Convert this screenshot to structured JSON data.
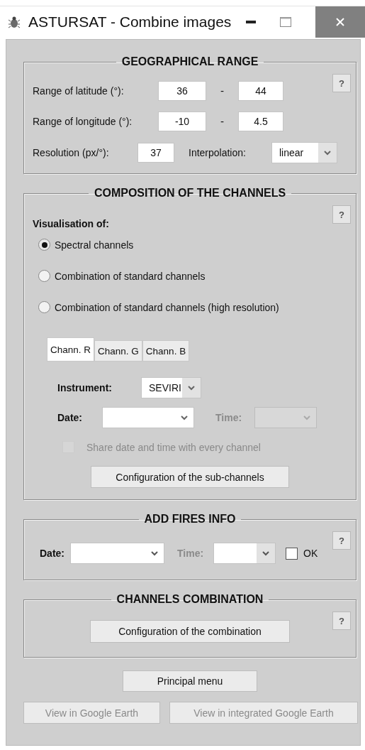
{
  "window": {
    "title": "ASTURSAT - Combine images"
  },
  "geographical_range": {
    "title": "GEOGRAPHICAL RANGE",
    "help": "?",
    "latitude": {
      "label": "Range of latitude (°):",
      "from": "36",
      "separator": "-",
      "to": "44"
    },
    "longitude": {
      "label": "Range of longitude (°):",
      "from": "-10",
      "separator": "-",
      "to": "4.5"
    },
    "resolution": {
      "label": "Resolution (px/°):",
      "value": "37"
    },
    "interpolation": {
      "label": "Interpolation:",
      "value": "linear"
    }
  },
  "composition": {
    "title": "COMPOSITION OF THE CHANNELS",
    "help": "?",
    "visualisation_label": "Visualisation of:",
    "options": [
      {
        "label": "Spectral channels",
        "selected": true
      },
      {
        "label": "Combination of standard channels",
        "selected": false
      },
      {
        "label": "Combination of standard channels (high resolution)",
        "selected": false
      }
    ],
    "tabs": [
      {
        "label": "Chann. R",
        "selected": true
      },
      {
        "label": "Chann. G",
        "selected": false
      },
      {
        "label": "Chann. B",
        "selected": false
      }
    ],
    "instrument": {
      "label": "Instrument:",
      "value": "SEVIRI"
    },
    "date": {
      "label": "Date:",
      "disabled": false
    },
    "time": {
      "label": "Time:",
      "disabled": true
    },
    "share": {
      "label": "Share date and time with every channel",
      "checked": false,
      "disabled": true
    },
    "subchannels_button": "Configuration of the sub-channels"
  },
  "fires": {
    "title": "ADD FIRES INFO",
    "help": "?",
    "date": {
      "label": "Date:",
      "disabled": false
    },
    "time": {
      "label": "Time:",
      "disabled": true
    },
    "ok": {
      "label": "OK",
      "checked": false
    }
  },
  "combination": {
    "title": "CHANNELS COMBINATION",
    "help": "?",
    "button": "Configuration of the combination"
  },
  "principal_button": {
    "label": "Principal menu",
    "disabled": false
  },
  "earth_buttons": [
    {
      "label": "View in Google Earth",
      "disabled": true
    },
    {
      "label": "View in integrated Google Earth",
      "disabled": true
    }
  ]
}
